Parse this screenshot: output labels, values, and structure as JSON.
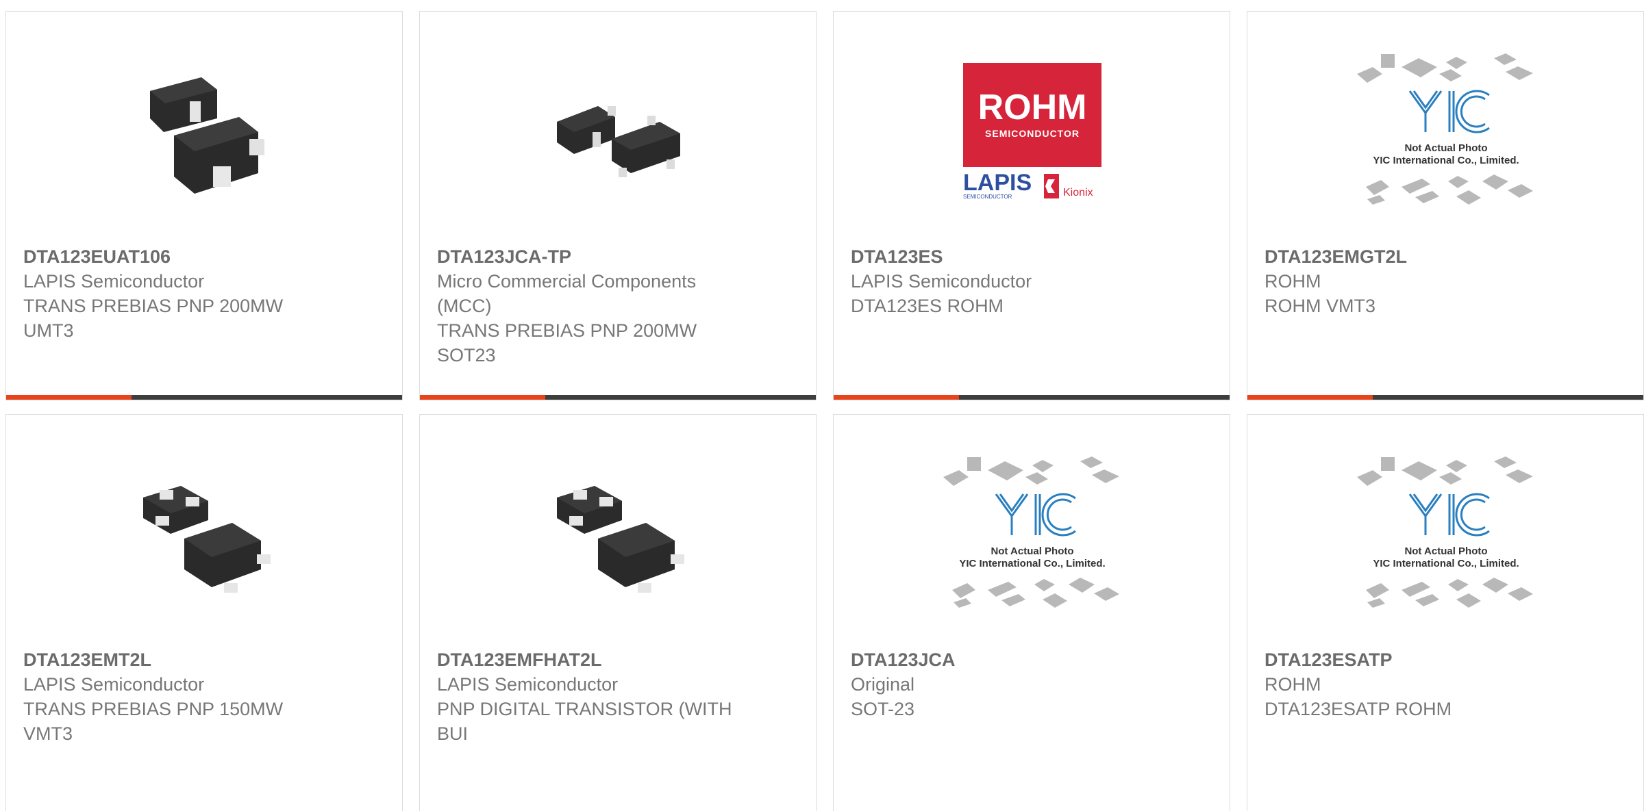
{
  "accent_color": "#e8441c",
  "bar_color": "#3d3d3d",
  "products": [
    {
      "part_number": "DTA123EUAT106",
      "manufacturer": "LAPIS Semiconductor",
      "description": "TRANS PREBIAS PNP 200MW UMT3",
      "image": "sot-package-chip-photo"
    },
    {
      "part_number": "DTA123JCA-TP",
      "manufacturer": "Micro Commercial Components (MCC)",
      "description": "TRANS PREBIAS PNP 200MW SOT23",
      "image": "sot23-chip-photo"
    },
    {
      "part_number": "DTA123ES",
      "manufacturer": "LAPIS Semiconductor",
      "description": "DTA123ES ROHM",
      "image": "rohm-lapis-kionix-logo",
      "logo": {
        "brand": "ROHM",
        "sub": "SEMICONDUCTOR",
        "lapis": "LAPIS",
        "lapis_sub": "SEMICONDUCTOR",
        "kionix": "Kionix"
      }
    },
    {
      "part_number": "DTA123EMGT2L",
      "manufacturer": "ROHM",
      "description": "ROHM VMT3",
      "image": "yic-not-actual-photo",
      "placeholder": {
        "brand": "YIC",
        "line1": "Not Actual Photo",
        "line2": "YIC International Co., Limited."
      }
    },
    {
      "part_number": "DTA123EMT2L",
      "manufacturer": "LAPIS Semiconductor",
      "description": "TRANS PREBIAS PNP 150MW VMT3",
      "image": "vmt3-chip-photo"
    },
    {
      "part_number": "DTA123EMFHAT2L",
      "manufacturer": "LAPIS Semiconductor",
      "description": "PNP DIGITAL TRANSISTOR (WITH BUI",
      "image": "vmt3-chip-photo"
    },
    {
      "part_number": "DTA123JCA",
      "manufacturer": "Original",
      "description": "SOT-23",
      "image": "yic-not-actual-photo",
      "placeholder": {
        "brand": "YIC",
        "line1": "Not Actual Photo",
        "line2": "YIC International Co., Limited."
      }
    },
    {
      "part_number": "DTA123ESATP",
      "manufacturer": "ROHM",
      "description": "DTA123ESATP ROHM",
      "image": "yic-not-actual-photo",
      "placeholder": {
        "brand": "YIC",
        "line1": "Not Actual Photo",
        "line2": "YIC International Co., Limited."
      }
    }
  ]
}
